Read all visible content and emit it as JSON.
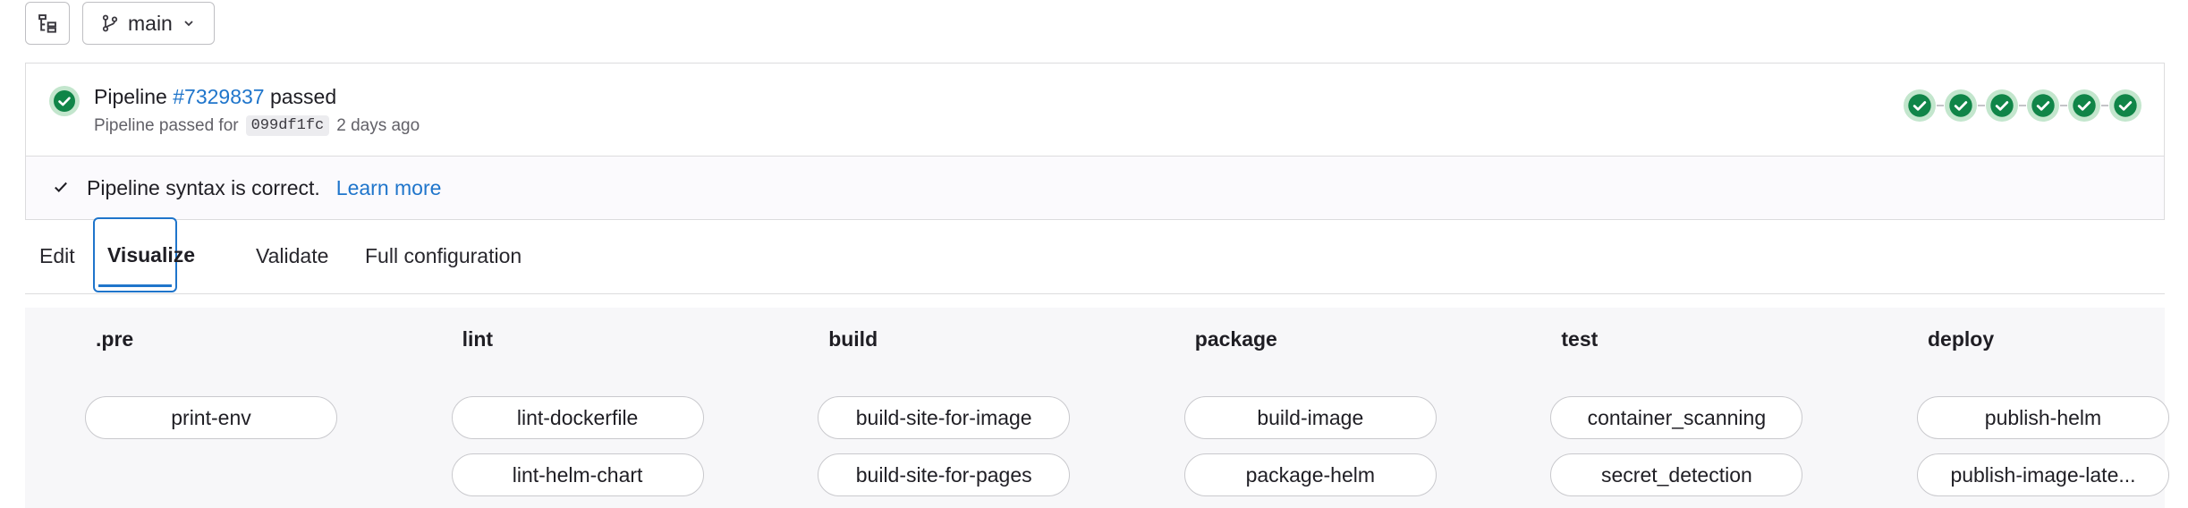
{
  "toolbar": {
    "branch": "main"
  },
  "pipeline": {
    "label": "Pipeline",
    "id_link": "#7329837",
    "status": "passed",
    "sub_prefix": "Pipeline passed for",
    "sha": "099df1fc",
    "time": "2 days ago",
    "mini_stage_count": 6,
    "status_color": "#108548"
  },
  "syntax": {
    "message": "Pipeline syntax is correct.",
    "learn_more": "Learn more"
  },
  "tabs": [
    {
      "label": "Edit"
    },
    {
      "label": "Visualize",
      "active": true
    },
    {
      "label": "Validate"
    },
    {
      "label": "Full configuration"
    }
  ],
  "stages": [
    {
      "name": ".pre",
      "jobs": [
        "print-env"
      ]
    },
    {
      "name": "lint",
      "jobs": [
        "lint-dockerfile",
        "lint-helm-chart"
      ]
    },
    {
      "name": "build",
      "jobs": [
        "build-site-for-image",
        "build-site-for-pages"
      ]
    },
    {
      "name": "package",
      "jobs": [
        "build-image",
        "package-helm"
      ]
    },
    {
      "name": "test",
      "jobs": [
        "container_scanning",
        "secret_detection"
      ]
    },
    {
      "name": "deploy",
      "jobs": [
        "publish-helm",
        "publish-image-late..."
      ]
    }
  ]
}
